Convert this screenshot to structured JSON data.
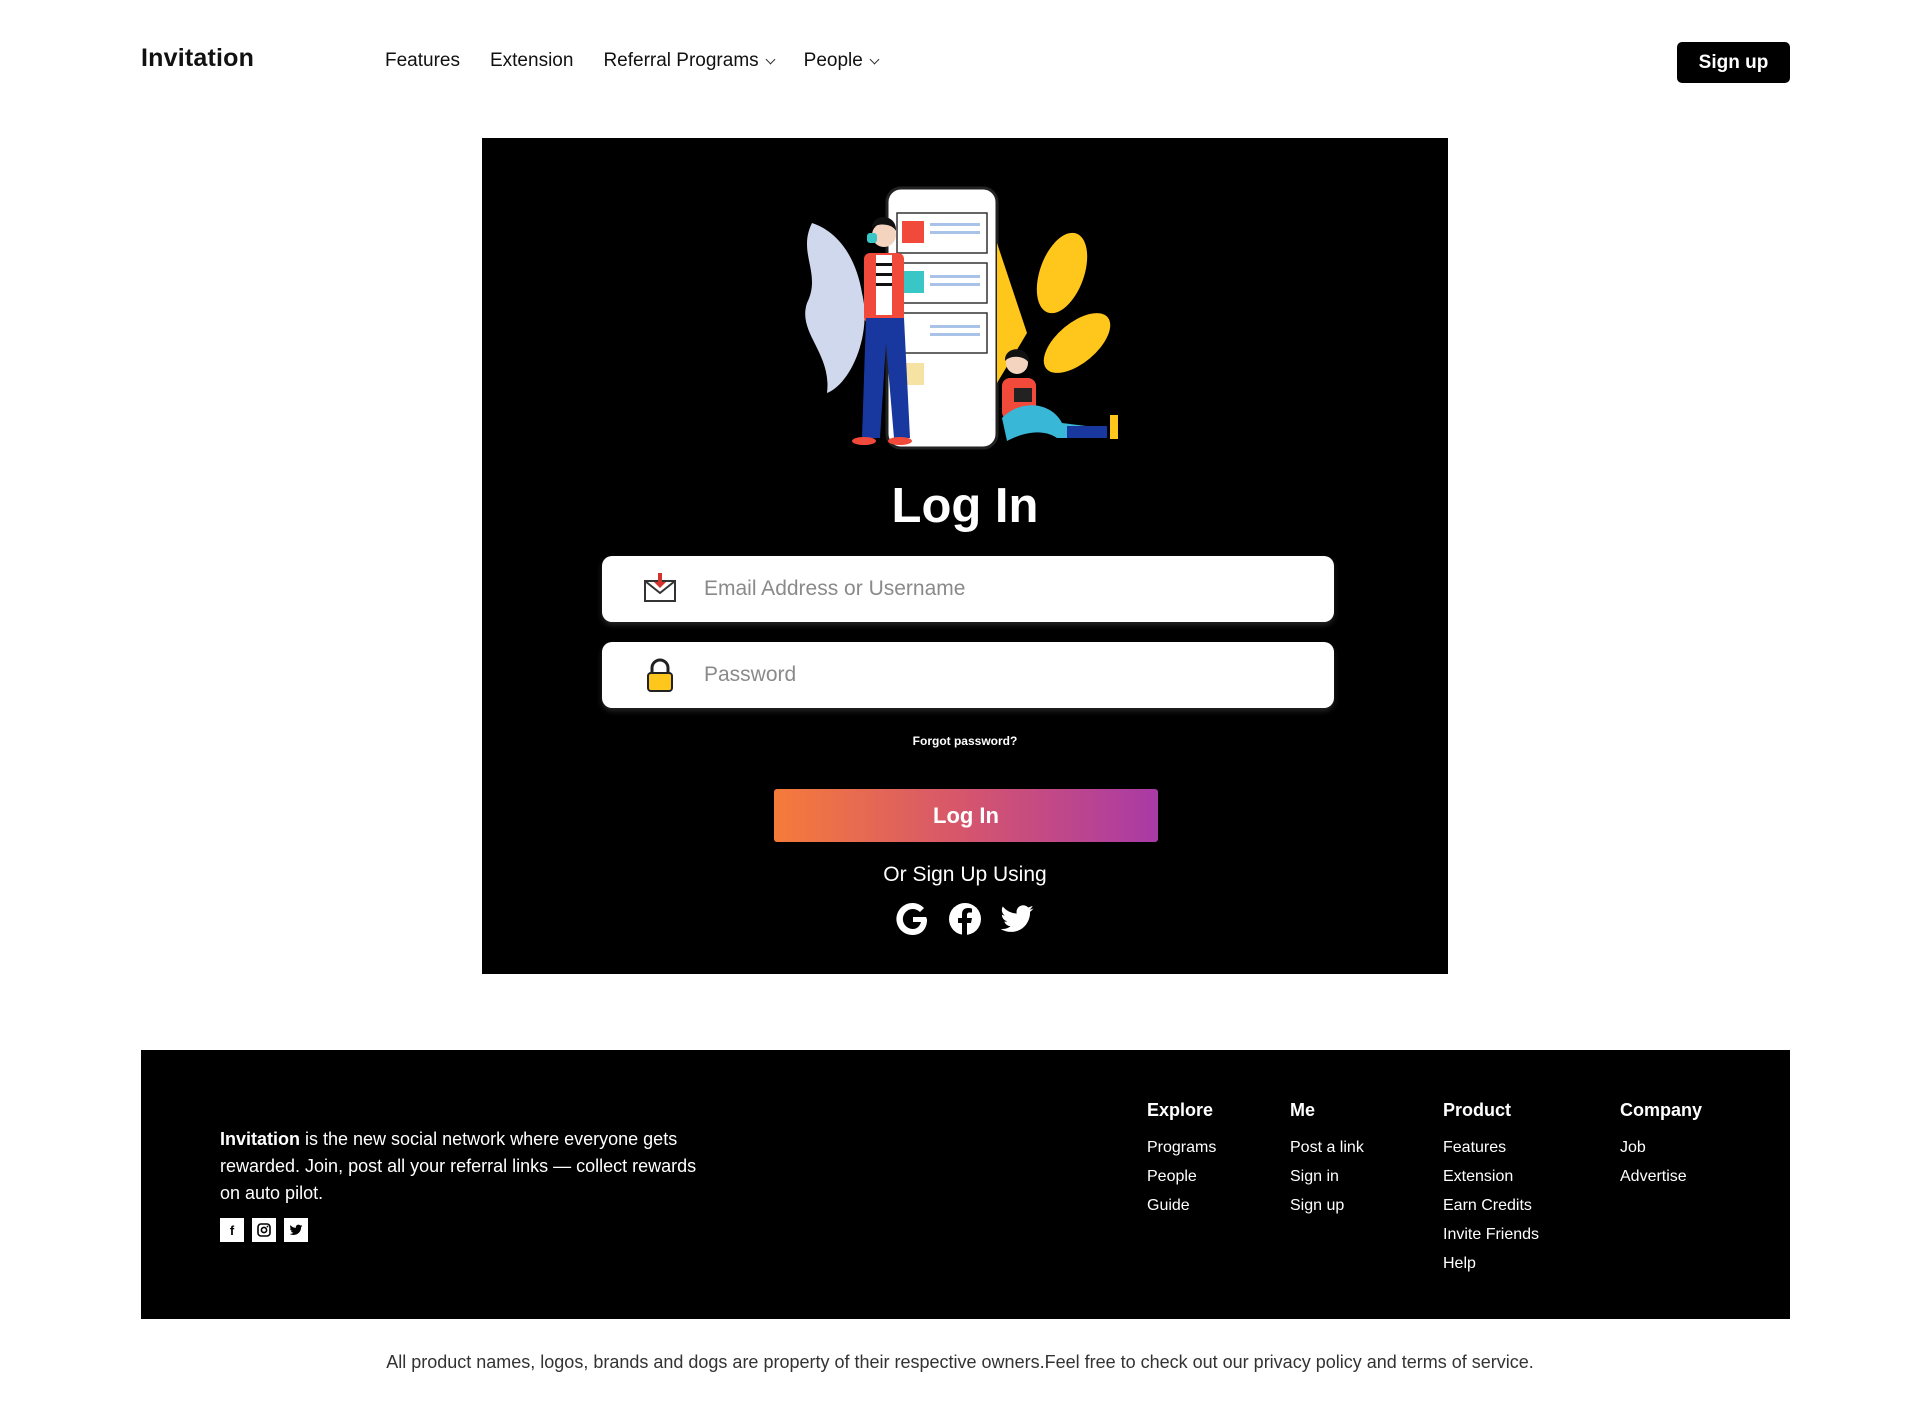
{
  "header": {
    "brand": "Invitation",
    "nav": [
      {
        "label": "Features",
        "has_dropdown": false
      },
      {
        "label": "Extension",
        "has_dropdown": false
      },
      {
        "label": "Referral Programs",
        "has_dropdown": true
      },
      {
        "label": "People",
        "has_dropdown": true
      }
    ],
    "signup_label": "Sign up"
  },
  "login": {
    "title": "Log In",
    "email_placeholder": "Email Address or Username",
    "email_icon": "envelope-icon",
    "password_placeholder": "Password",
    "password_icon": "lock-icon",
    "forgot": "Forgot password?",
    "button": "Log In",
    "or_text": "Or Sign Up Using",
    "socials": [
      "google-icon",
      "facebook-icon",
      "twitter-icon"
    ],
    "button_gradient": [
      "#f57b3a",
      "#a93aa6"
    ]
  },
  "footer": {
    "about_brand": "Invitation",
    "about_text": " is the new social network where everyone gets rewarded. Join, post all your referral links — collect rewards on auto pilot.",
    "social_icons": [
      "facebook-icon",
      "instagram-icon",
      "twitter-icon"
    ],
    "columns": [
      {
        "title": "Explore",
        "links": [
          "Programs",
          "People",
          "Guide"
        ]
      },
      {
        "title": "Me",
        "links": [
          "Post a link",
          "Sign in",
          "Sign up"
        ]
      },
      {
        "title": "Product",
        "links": [
          "Features",
          "Extension",
          "Earn Credits",
          "Invite Friends",
          "Help"
        ]
      },
      {
        "title": "Company",
        "links": [
          "Job",
          "Advertise"
        ]
      }
    ]
  },
  "legal": "All product names, logos, brands and dogs are property of their respective owners.Feel free to check out our privacy policy and terms of service."
}
